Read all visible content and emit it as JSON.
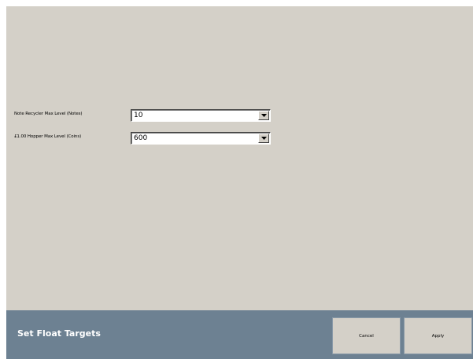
{
  "form": {
    "rows": [
      {
        "label": "Note Recycler Max Level (Notes)",
        "value": "10"
      },
      {
        "label": "£1.00 Hopper Max Level (Coins)",
        "value": "600"
      }
    ]
  },
  "footer": {
    "title": "Set Float Targets",
    "cancel_label": "Cancel",
    "apply_label": "Apply"
  },
  "icons": {
    "dropdown": "chevron-down-icon"
  },
  "colors": {
    "background": "#d4d0c8",
    "footer_bar": "#6d8192",
    "footer_text": "#ffffff"
  }
}
